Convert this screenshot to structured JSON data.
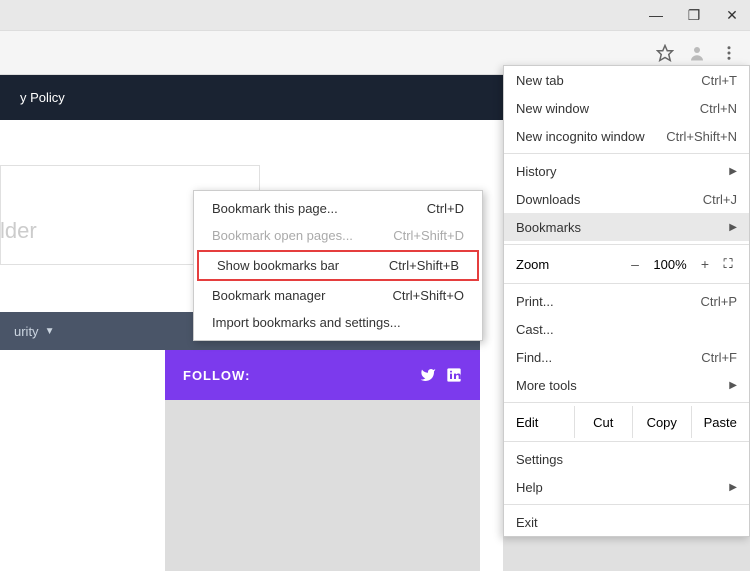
{
  "win": {
    "min": "—",
    "max": "❐",
    "close": "✕"
  },
  "hdr": "y Policy",
  "ph": "lder",
  "sec": "urity",
  "follow": "FOLLOW:",
  "menu": {
    "newtab": "New tab",
    "newtab_s": "Ctrl+T",
    "newwin": "New window",
    "newwin_s": "Ctrl+N",
    "incog": "New incognito window",
    "incog_s": "Ctrl+Shift+N",
    "hist": "History",
    "dl": "Downloads",
    "dl_s": "Ctrl+J",
    "bm": "Bookmarks",
    "zoom": "Zoom",
    "zm": "–",
    "zv": "100%",
    "zp": "+",
    "print": "Print...",
    "print_s": "Ctrl+P",
    "cast": "Cast...",
    "find": "Find...",
    "find_s": "Ctrl+F",
    "more": "More tools",
    "edit": "Edit",
    "cut": "Cut",
    "copy": "Copy",
    "paste": "Paste",
    "set": "Settings",
    "help": "Help",
    "exit": "Exit"
  },
  "sub": {
    "bp": "Bookmark this page...",
    "bp_s": "Ctrl+D",
    "bo": "Bookmark open pages...",
    "bo_s": "Ctrl+Shift+D",
    "sb": "Show bookmarks bar",
    "sb_s": "Ctrl+Shift+B",
    "bm": "Bookmark manager",
    "bm_s": "Ctrl+Shift+O",
    "im": "Import bookmarks and settings..."
  }
}
